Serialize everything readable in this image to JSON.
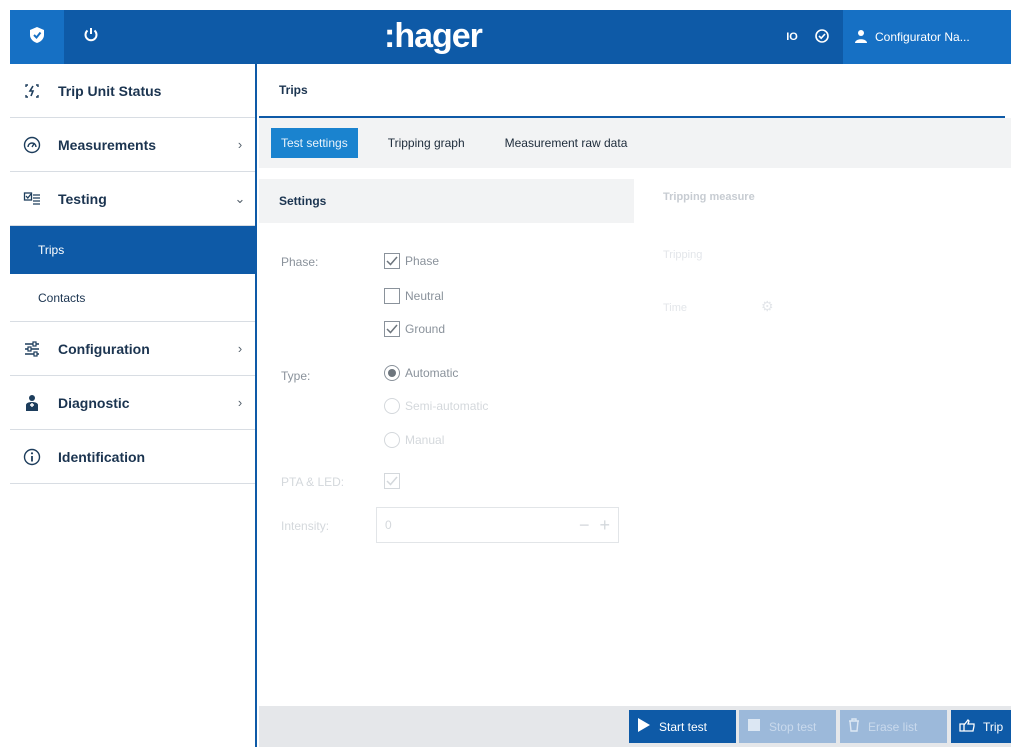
{
  "header": {
    "logo": ":hager",
    "indicator_label": "IO",
    "user_name": "Configurator Na..."
  },
  "sidebar": {
    "items": [
      {
        "label": "Trip Unit Status",
        "icon": "trip-unit-status-icon"
      },
      {
        "label": "Measurements",
        "icon": "measurements-icon",
        "chevron": ">"
      },
      {
        "label": "Testing",
        "icon": "testing-icon",
        "chevron": "v"
      },
      {
        "label": "Configuration",
        "icon": "configuration-icon",
        "chevron": ">"
      },
      {
        "label": "Diagnostic",
        "icon": "diagnostic-icon",
        "chevron": ">"
      },
      {
        "label": "Identification",
        "icon": "identification-icon"
      }
    ],
    "testing_sub": [
      {
        "label": "Trips",
        "active": true
      },
      {
        "label": "Contacts",
        "active": false
      }
    ]
  },
  "main": {
    "page_title": "Trips",
    "tabs": [
      {
        "label": "Test settings",
        "active": true
      },
      {
        "label": "Tripping graph",
        "active": false
      },
      {
        "label": "Measurement raw data",
        "active": false
      }
    ],
    "settings_title": "Settings",
    "tripping_measure_title": "Tripping measure",
    "tripping_ghost": [
      "Tripping",
      "Time"
    ],
    "phase_label": "Phase:",
    "phase_options": [
      {
        "label": "Phase",
        "checked": true
      },
      {
        "label": "Neutral",
        "checked": false
      },
      {
        "label": "Ground",
        "checked": true
      }
    ],
    "type_label": "Type:",
    "type_options": [
      {
        "label": "Automatic",
        "selected": true
      },
      {
        "label": "Semi-automatic",
        "selected": false
      },
      {
        "label": "Manual",
        "selected": false
      }
    ],
    "pta_label": "PTA & LED:",
    "intensity_label": "Intensity:",
    "intensity_value": "0"
  },
  "actions": {
    "start_test": "Start test",
    "stop_test": "Stop test",
    "erase_list": "Erase list",
    "trip": "Trip"
  },
  "colors": {
    "brand": "#0e5aa7",
    "active_tab": "#1a83cf"
  }
}
